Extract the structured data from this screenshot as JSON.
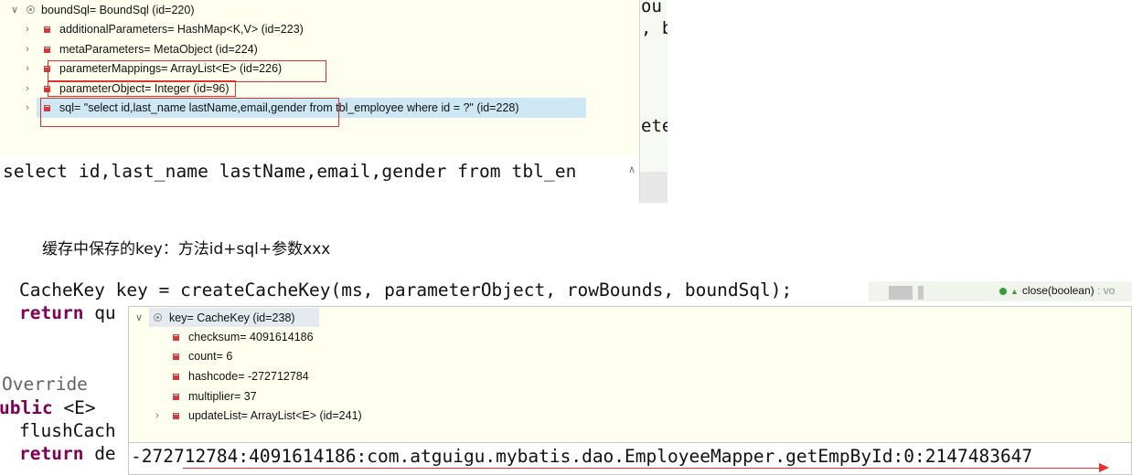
{
  "top_variables": {
    "root": {
      "label": "boundSql= BoundSql  (id=220)",
      "expanded_icon": "chevron-down-icon"
    },
    "children": [
      {
        "label": "additionalParameters= HashMap<K,V>  (id=223)"
      },
      {
        "label": "metaParameters= MetaObject  (id=224)"
      },
      {
        "label": "parameterMappings= ArrayList<E>  (id=226)"
      },
      {
        "label": "parameterObject= Integer  (id=96)"
      },
      {
        "label": "sql= \"select id,last_name lastName,email,gender from tbl_employee where id = ?\" (id=228)"
      }
    ],
    "sql_detail": "select id,last_name lastName,email,gender from tbl_en"
  },
  "right_editor_fragments": [
    "ou",
    ", b",
    "ete"
  ],
  "caption": "缓存中保存的key：方法id+sql+参数xxx",
  "code": {
    "line1": "CacheKey key = createCacheKey(ms, parameterObject, rowBounds, boundSql);",
    "line2_kw": "return",
    "line2_rest": " qu",
    "line3": "Override",
    "line4_kw": "ublic",
    "line4_rest": " <E>",
    "line5": "flushCach",
    "line6_kw": "return",
    "line6_rest": " de"
  },
  "outline": {
    "label": "close(boolean)",
    "type_suffix": " : vo"
  },
  "popup_variables": {
    "root": {
      "label": "key= CacheKey  (id=238)"
    },
    "children": [
      {
        "label": "checksum= 4091614186"
      },
      {
        "label": "count= 6"
      },
      {
        "label": "hashcode= -272712784"
      },
      {
        "label": "multiplier= 37"
      },
      {
        "label": "updateList= ArrayList<E>  (id=241)"
      }
    ],
    "value_detail": "-272712784:4091614186:com.atguigu.mybatis.dao.EmployeeMapper.getEmpById:0:2147483647"
  },
  "colors": {
    "annotation_red": "#e03030",
    "keyword": "#7f0055",
    "variables_bg": "#fffff0",
    "selection": "#cde7f5"
  }
}
